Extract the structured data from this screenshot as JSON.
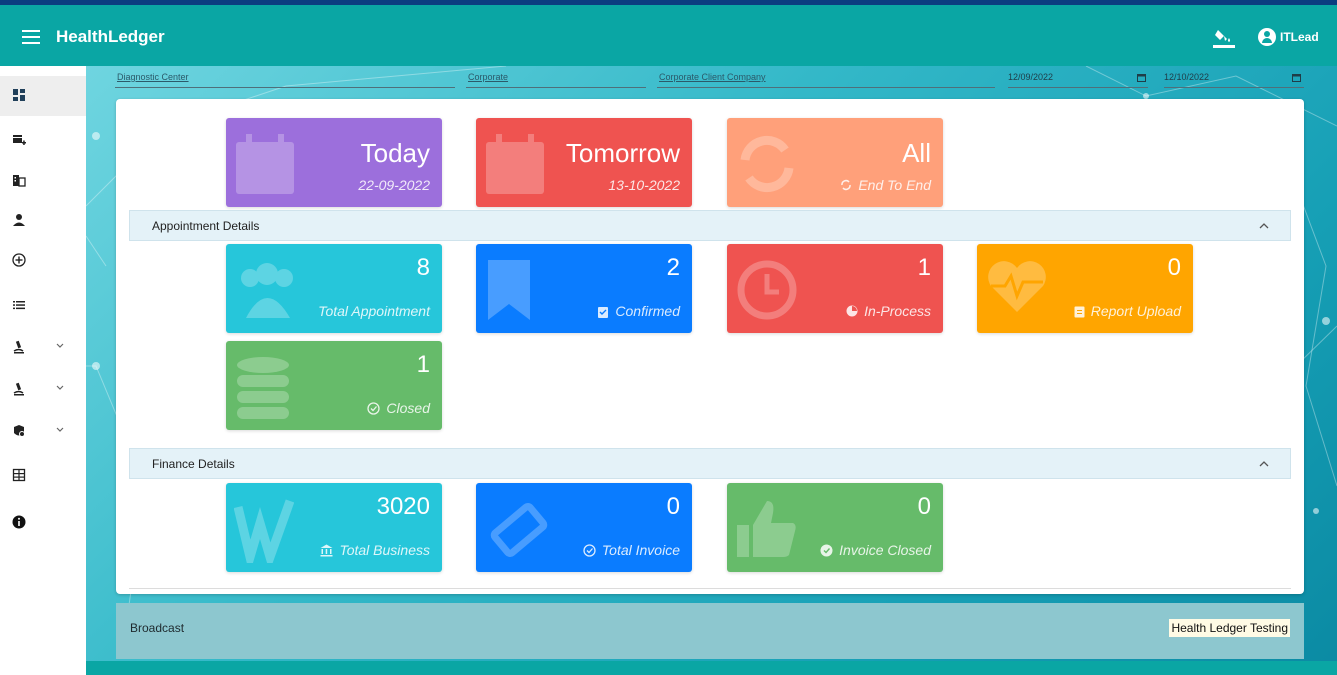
{
  "app": {
    "title": "HealthLedger",
    "user": "ITLead"
  },
  "icons": {
    "menu": "hamburger-icon",
    "theme": "paint-bucket-icon",
    "user": "account-circle-icon"
  },
  "colors": {
    "topbar": "#0aa6a4",
    "purple": "#9c6fdc",
    "red": "#ef5350",
    "salmon": "#ffa07a",
    "cyan": "#26c6da",
    "blue": "#0a7cff",
    "orange": "#ffa500",
    "green": "#66bb6a"
  },
  "filters": {
    "diagnostic_center": "Diagnostic Center",
    "corporate": "Corporate",
    "corporate_client": "Corporate Client Company",
    "from_date": "12/09/2022",
    "to_date": "12/10/2022"
  },
  "period_tiles": [
    {
      "title": "Today",
      "subtitle": "22-09-2022"
    },
    {
      "title": "Tomorrow",
      "subtitle": "13-10-2022"
    },
    {
      "title": "All",
      "subtitle": "End To End"
    }
  ],
  "appointment_section": {
    "label": "Appointment Details"
  },
  "appointment_tiles": [
    {
      "value": "8",
      "label": "Total Appointment"
    },
    {
      "value": "2",
      "label": "Confirmed"
    },
    {
      "value": "1",
      "label": "In-Process"
    },
    {
      "value": "0",
      "label": "Report Upload"
    },
    {
      "value": "1",
      "label": "Closed"
    }
  ],
  "finance_section": {
    "label": "Finance Details"
  },
  "finance_tiles": [
    {
      "value": "3020",
      "label": "Total Business"
    },
    {
      "value": "0",
      "label": "Total Invoice"
    },
    {
      "value": "0",
      "label": "Invoice Closed"
    }
  ],
  "broadcast": {
    "label": "Broadcast",
    "message": "Health Ledger Testing"
  },
  "sidebar_items": [
    {
      "icon": "dashboard-icon"
    },
    {
      "icon": "store-add-icon"
    },
    {
      "icon": "building-icon"
    },
    {
      "icon": "person-icon"
    },
    {
      "icon": "add-circle-icon"
    },
    {
      "icon": "list-icon"
    },
    {
      "icon": "microscope-icon",
      "expandable": true
    },
    {
      "icon": "microscope-icon",
      "expandable": true
    },
    {
      "icon": "medical-bag-icon",
      "expandable": true
    },
    {
      "icon": "table-icon"
    },
    {
      "icon": "info-icon"
    }
  ]
}
